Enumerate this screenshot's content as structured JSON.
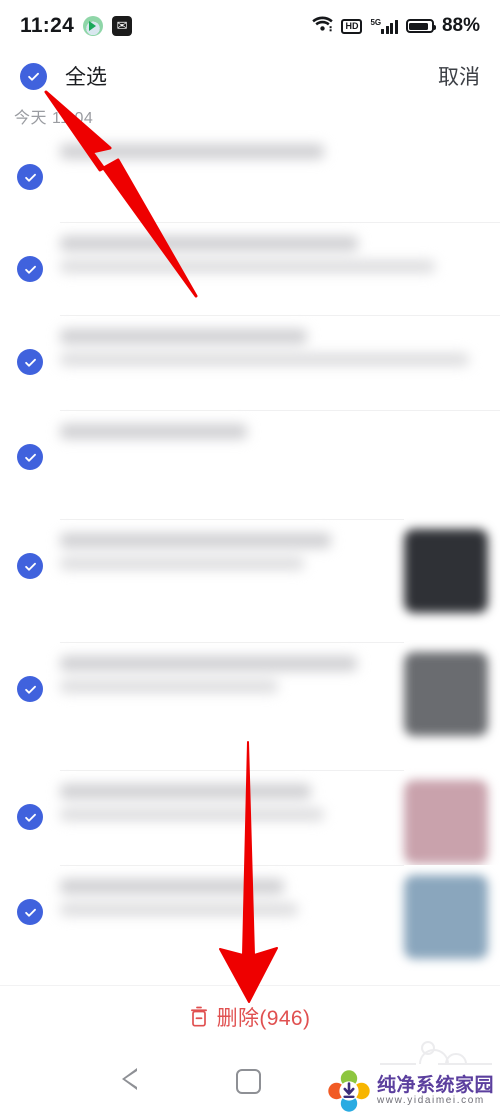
{
  "statusbar": {
    "time": "11:24",
    "app_icons": [
      "video-app-icon",
      "mail-app-icon"
    ],
    "wifi_icon": "wifi-icon",
    "hd_label": "HD",
    "network_label": "5G",
    "signal_icon": "signal-bars-icon",
    "battery_icon": "battery-icon",
    "battery_percent": "88%"
  },
  "actionbar": {
    "select_all_label": "全选",
    "cancel_label": "取消",
    "checkbox_icon": "check-icon",
    "checked": true
  },
  "list": {
    "date_header": "今天 11:04",
    "rows": [
      {
        "checked": true,
        "lines": [
          62,
          0
        ],
        "has_thumb": false,
        "thumb_color": ""
      },
      {
        "checked": true,
        "lines": [
          70,
          88
        ],
        "has_thumb": false,
        "thumb_color": ""
      },
      {
        "checked": true,
        "lines": [
          58,
          96
        ],
        "has_thumb": false,
        "thumb_color": ""
      },
      {
        "checked": true,
        "lines": [
          44,
          0
        ],
        "has_thumb": false,
        "thumb_color": ""
      },
      {
        "checked": true,
        "lines": [
          82,
          74
        ],
        "has_thumb": true,
        "thumb_color": "#2f3136"
      },
      {
        "checked": true,
        "lines": [
          90,
          66
        ],
        "has_thumb": true,
        "thumb_color": "#6a6c70"
      },
      {
        "checked": true,
        "lines": [
          76,
          80
        ],
        "has_thumb": true,
        "thumb_color": "#c9a2ac"
      },
      {
        "checked": true,
        "lines": [
          68,
          72
        ],
        "has_thumb": true,
        "thumb_color": "#8aa6bd"
      }
    ]
  },
  "deletebar": {
    "trash_icon": "trash-icon",
    "label": "删除(946)",
    "count": 946,
    "color": "#e05050"
  },
  "navbar": {
    "back_icon": "back-triangle-icon",
    "home_icon": "home-square-icon"
  },
  "annotations": {
    "arrow_top": {
      "name": "arrow-to-select-all",
      "color": "#ee0000"
    },
    "arrow_bottom": {
      "name": "arrow-to-delete-button",
      "color": "#ee0000"
    }
  },
  "watermark": {
    "logo_icon": "download-flower-logo-icon",
    "brand": "纯净系统家园",
    "url": "www.yidaimei.com"
  },
  "colors": {
    "accent_blue": "#4062dd",
    "danger_red": "#e05050",
    "annotation_red": "#ee0000",
    "text_primary": "#1a1c20",
    "text_muted": "#9a9ca1"
  }
}
